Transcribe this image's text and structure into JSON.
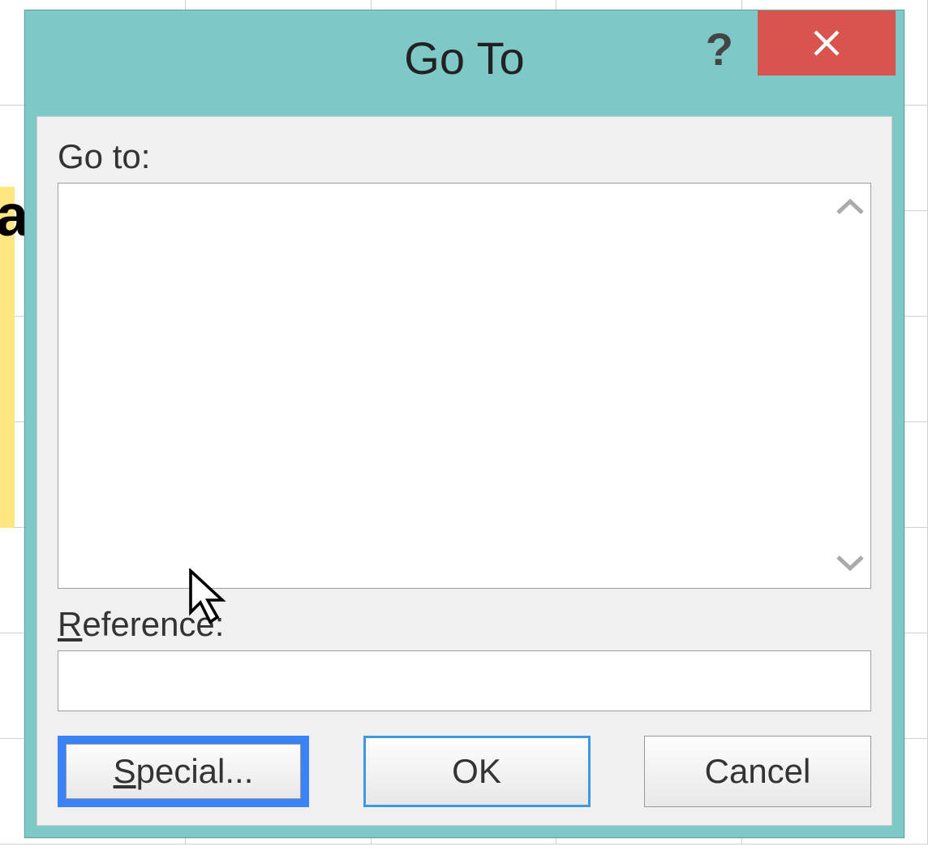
{
  "titlebar": {
    "title": "Go To",
    "help_symbol": "?",
    "close_symbol": "×"
  },
  "body": {
    "goto_label": "Go to:",
    "reference_label_prefix": "R",
    "reference_label_rest": "eference:",
    "reference_value": ""
  },
  "buttons": {
    "special_prefix": "S",
    "special_rest": "pecial...",
    "ok": "OK",
    "cancel": "Cancel"
  },
  "colors": {
    "titlebar_bg": "#7ec8c8",
    "close_bg": "#d9534f",
    "highlight_border": "#3b82f6",
    "ok_border": "#3b9ae1"
  }
}
